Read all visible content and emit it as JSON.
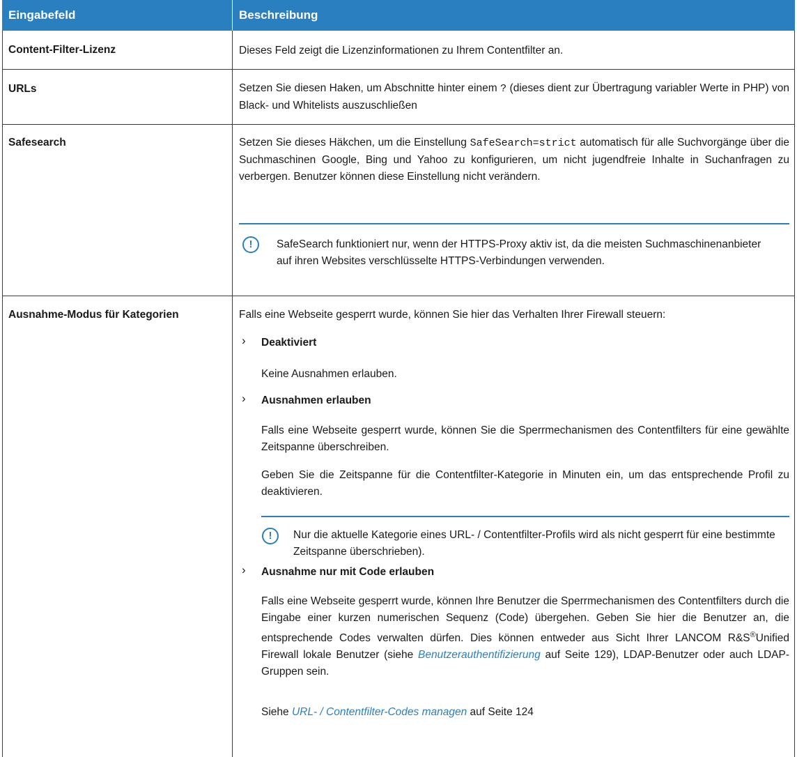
{
  "header": {
    "col1": "Eingabefeld",
    "col2": "Beschreibung"
  },
  "rows": [
    {
      "label": "Content-Filter-Lizenz",
      "text": "Dieses Feld zeigt die Lizenzinformationen zu Ihrem Contentfilter an."
    },
    {
      "label": "URLs",
      "text_before": "Setzen Sie diesen Haken, um Abschnitte hinter einem ",
      "code": "?",
      "text_after": " (dieses dient zur Übertragung variabler Werte in PHP) von Black- und Whitelists auszuschließen"
    },
    {
      "label": "Safesearch",
      "text_before": "Setzen Sie dieses Häkchen, um die Einstellung ",
      "code": "SafeSearch=strict",
      "text_after": " automatisch für alle Suchvorgänge über die Suchmaschinen Google, Bing und Yahoo zu konfigurieren, um nicht jugendfreie Inhalte in Suchanfragen zu verbergen. Benutzer können diese Einstellung nicht verändern.",
      "note": "SafeSearch funktioniert nur, wenn der HTTPS-Proxy aktiv ist, da die meisten Suchmaschinenanbieter auf ihren Websites verschlüsselte HTTPS-Verbindungen verwenden."
    },
    {
      "label": "Ausnahme-Modus für Kategorien",
      "intro": "Falls eine Webseite gesperrt wurde, können Sie hier das Verhalten Ihrer Firewall steuern:",
      "options": [
        {
          "title": "Deaktiviert",
          "text": "Keine Ausnahmen erlauben."
        },
        {
          "title": "Ausnahmen erlauben",
          "text1": "Falls eine Webseite gesperrt wurde, können Sie die Sperrmechanismen des Contentfilters für eine gewählte Zeitspanne überschreiben.",
          "text2": "Geben Sie die Zeitspanne für die Contentfilter-Kategorie in Minuten ein, um das entsprechende Profil zu deaktivieren.",
          "note": "Nur die aktuelle Kategorie eines URL- / Contentfilter-Profils wird als nicht gesperrt für eine bestimmte Zeitspanne überschrieben)."
        },
        {
          "title": "Ausnahme nur mit Code erlauben",
          "text_a": "Falls eine Webseite gesperrt wurde, können Ihre Benutzer die Sperrmechanismen des Contentfilters durch die Eingabe einer kurzen numerischen Sequenz (Code) übergehen. Geben Sie hier die Benutzer an, die entsprechende Codes verwalten dürfen. Dies können entweder aus Sicht Ihrer LANCOM R&S",
          "reg": "®",
          "text_b": "Unified Firewall lokale Benutzer (siehe ",
          "link1": "Benutzerauthentifizierung",
          "text_c": " auf Seite 129), LDAP-Benutzer oder auch LDAP-Gruppen sein.",
          "see_prefix": "Siehe ",
          "link2": "URL- / Contentfilter-Codes managen",
          "see_suffix": " auf Seite 124"
        }
      ]
    }
  ],
  "icons": {
    "chevron": "chevron-right-icon",
    "note": "exclamation-circle-icon"
  },
  "colors": {
    "header_bg": "#2a7fc1",
    "accent": "#2a7fc1"
  }
}
